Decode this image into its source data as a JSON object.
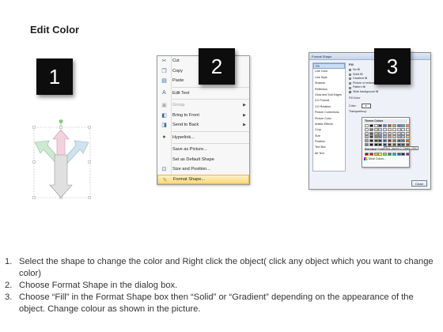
{
  "page": {
    "title": "Edit Color"
  },
  "badges": [
    "1",
    "2",
    "3"
  ],
  "context_menu": {
    "items": [
      {
        "label": "Cut",
        "icon": "scissors-icon",
        "disabled": false,
        "submenu": false
      },
      {
        "label": "Copy",
        "icon": "copy-icon",
        "disabled": false,
        "submenu": false
      },
      {
        "label": "Paste",
        "icon": "paste-icon",
        "disabled": false,
        "submenu": false
      },
      {
        "label": "Edit Text",
        "icon": "edit-text-icon",
        "disabled": false,
        "submenu": false
      },
      {
        "label": "Group",
        "icon": "group-icon",
        "disabled": true,
        "submenu": true
      },
      {
        "label": "Bring to Front",
        "icon": "bring-front-icon",
        "disabled": false,
        "submenu": true
      },
      {
        "label": "Send to Back",
        "icon": "send-back-icon",
        "disabled": false,
        "submenu": true
      },
      {
        "label": "Hyperlink...",
        "icon": "hyperlink-icon",
        "disabled": false,
        "submenu": false
      },
      {
        "label": "Save as Picture...",
        "icon": "",
        "disabled": false,
        "submenu": false
      },
      {
        "label": "Set as Default Shape",
        "icon": "",
        "disabled": false,
        "submenu": false
      },
      {
        "label": "Size and Position...",
        "icon": "size-icon",
        "disabled": false,
        "submenu": false
      },
      {
        "label": "Format Shape...",
        "icon": "format-shape-icon",
        "disabled": false,
        "submenu": false,
        "highlighted": true
      }
    ]
  },
  "format_dialog": {
    "title": "Format Shape",
    "nav": [
      "Fill",
      "Line Color",
      "Line Style",
      "Shadow",
      "Reflection",
      "Glow and Soft Edges",
      "3-D Format",
      "3-D Rotation",
      "Picture Corrections",
      "Picture Color",
      "Artistic Effects",
      "Crop",
      "Size",
      "Position",
      "Text Box",
      "Alt Text"
    ],
    "fill_header": "Fill",
    "fill_options": [
      "No fill",
      "Solid fill",
      "Gradient fill",
      "Picture or texture fill",
      "Pattern fill",
      "Slide background fill"
    ],
    "fill_color_label": "Fill Color",
    "color_label": "Color:",
    "transparency_label": "Transparency:",
    "close_label": "Close",
    "popup": {
      "theme_label": "Theme Colors",
      "standard_label": "Standard Colors",
      "more_label": "More Colors...",
      "tooltip": "Red, Accent 2, Darker 25%"
    },
    "theme_colors": [
      "#ffffff",
      "#000000",
      "#eeece1",
      "#1f497d",
      "#4f81bd",
      "#c0504d",
      "#9bbb59",
      "#8064a2",
      "#4bacc6",
      "#f79646",
      "#f2f2f2",
      "#7f7f7f",
      "#ddd9c3",
      "#c6d9f0",
      "#dbe5f1",
      "#f2dcdb",
      "#ebf1dd",
      "#e5e0ec",
      "#dbeef3",
      "#fdeada",
      "#d8d8d8",
      "#595959",
      "#c4bd97",
      "#8db3e2",
      "#b8cce4",
      "#e5b9b7",
      "#d7e3bc",
      "#ccc1d9",
      "#b7dde8",
      "#fbd5b5",
      "#bfbfbf",
      "#3f3f3f",
      "#938953",
      "#548dd4",
      "#95b3d7",
      "#d99694",
      "#c3d69b",
      "#b2a2c7",
      "#92cddc",
      "#fac08f",
      "#a5a5a5",
      "#262626",
      "#494429",
      "#17365d",
      "#366092",
      "#953734",
      "#76923c",
      "#5f497a",
      "#31859b",
      "#e36c09",
      "#7f7f7f",
      "#0c0c0c",
      "#1d1b10",
      "#0f243e",
      "#244061",
      "#632423",
      "#4f6128",
      "#3f3151",
      "#205867",
      "#974806"
    ],
    "standard_colors": [
      "#c00000",
      "#ff0000",
      "#ffc000",
      "#ffff00",
      "#92d050",
      "#00b050",
      "#00b0f0",
      "#0070c0",
      "#002060",
      "#7030a0"
    ]
  },
  "instructions": [
    {
      "num": "1.",
      "text": "Select the shape to change the color and Right click the object( click any object which you want to change color)"
    },
    {
      "num": "2.",
      "text": "Choose Format Shape in the dialog box."
    },
    {
      "num": "3.",
      "text": "Choose “Fill” in the Format Shape box then “Solid” or “Gradient” depending on the appearance of the object. Change colour as shown in the picture."
    }
  ]
}
